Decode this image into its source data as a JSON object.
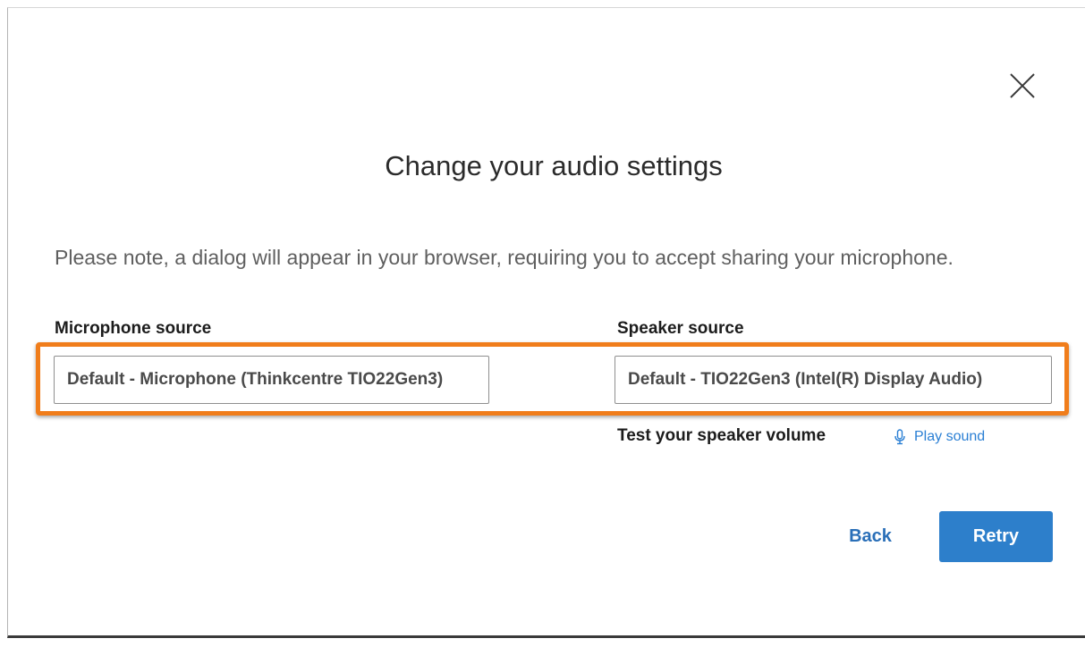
{
  "dialog": {
    "title": "Change your audio settings",
    "note": "Please note, a dialog will appear in your browser, requiring you to accept sharing your microphone.",
    "close_icon": "close-icon"
  },
  "microphone": {
    "label": "Microphone source",
    "value": "Default - Microphone (Thinkcentre TIO22Gen3)"
  },
  "speaker": {
    "label": "Speaker source",
    "value": "Default - TIO22Gen3 (Intel(R) Display Audio)",
    "test_label": "Test your speaker volume",
    "play_label": "Play sound",
    "play_icon": "microphone-icon"
  },
  "actions": {
    "back_label": "Back",
    "retry_label": "Retry"
  },
  "colors": {
    "accent": "#2d7fcb",
    "highlight": "#f07d1b",
    "link": "#2a7fd4"
  }
}
